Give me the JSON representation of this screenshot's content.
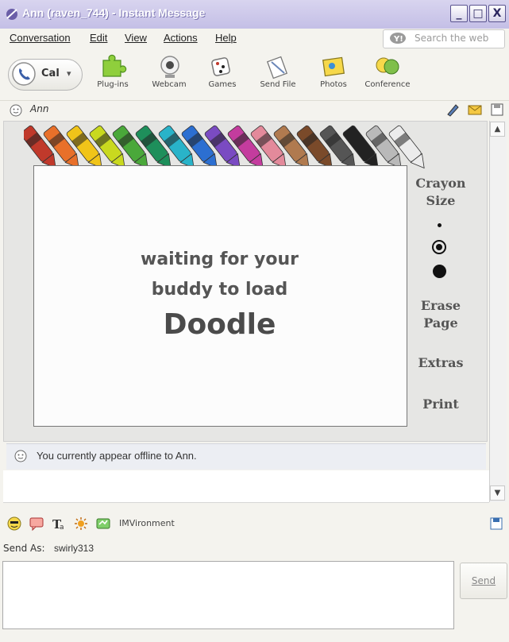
{
  "window": {
    "title": "Ann (raven_744) - Instant Message",
    "controls": {
      "minimize": "_",
      "maximize": "□",
      "close": "X"
    }
  },
  "menu": {
    "items": [
      "Conversation",
      "Edit",
      "View",
      "Actions",
      "Help"
    ],
    "search_placeholder": "Search the web"
  },
  "toolbar": {
    "call_label": "Cal",
    "items": [
      {
        "label": "Plug-ins",
        "icon": "puzzle-icon"
      },
      {
        "label": "Webcam",
        "icon": "webcam-icon"
      },
      {
        "label": "Games",
        "icon": "dice-icon"
      },
      {
        "label": "Send File",
        "icon": "send-file-icon"
      },
      {
        "label": "Photos",
        "icon": "photos-icon"
      },
      {
        "label": "Conference",
        "icon": "conference-icon"
      }
    ]
  },
  "contact": {
    "name": "Ann"
  },
  "doodle": {
    "message_line1": "waiting for your",
    "message_line2": "buddy to load",
    "message_line3": "Doodle",
    "crayon_size_label": "Crayon Size",
    "erase_label": "Erase Page",
    "extras_label": "Extras",
    "print_label": "Print",
    "crayon_colors": [
      "#c0392b",
      "#e8702a",
      "#f0c419",
      "#c9d91f",
      "#4aa83a",
      "#1e8f5b",
      "#29b3c9",
      "#2c6fd1",
      "#7a4bc2",
      "#c43c9e",
      "#e38a9b",
      "#b07a4f",
      "#7a4a2a",
      "#555555",
      "#222222",
      "#b9b9b9",
      "#ececec"
    ]
  },
  "status": {
    "offline_message": "You currently appear offline to Ann."
  },
  "format_bar": {
    "icons": [
      "emoticon-icon",
      "nudge-icon",
      "font-icon",
      "sun-icon",
      "imvironment-icon"
    ],
    "imvironment_label": "IMVironment"
  },
  "send": {
    "send_as_label": "Send As:",
    "send_as_id": "swirly313",
    "message_value": "",
    "button_label": "Send"
  }
}
